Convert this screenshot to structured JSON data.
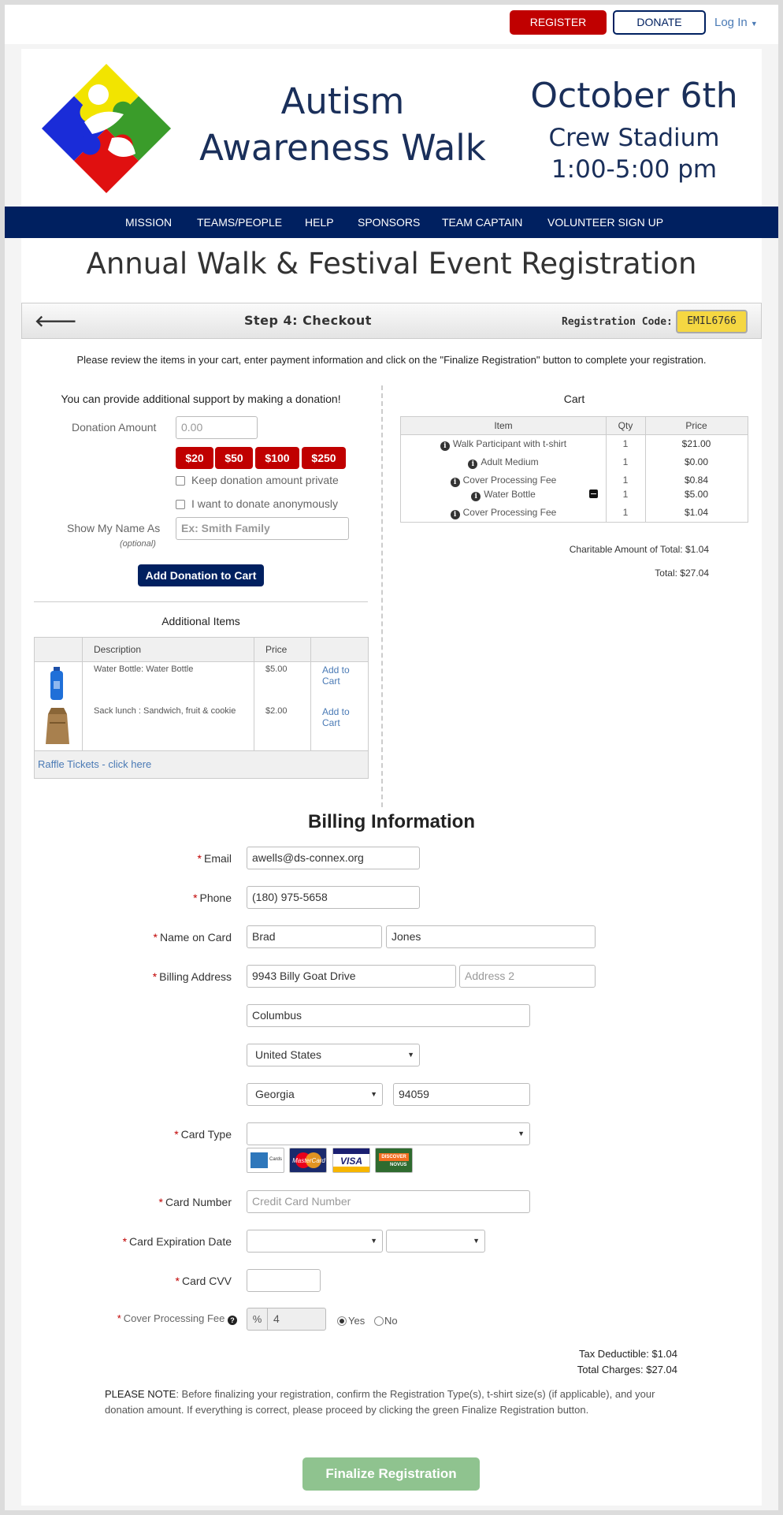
{
  "topbar": {
    "register": "REGISTER",
    "donate": "DONATE",
    "login": "Log In"
  },
  "hero": {
    "title_line1": "Autism",
    "title_line2": "Awareness Walk",
    "date": "October 6th",
    "venue": "Crew Stadium",
    "time": "1:00-5:00 pm"
  },
  "nav": [
    "MISSION",
    "TEAMS/PEOPLE",
    "HELP",
    "SPONSORS",
    "TEAM CAPTAIN",
    "VOLUNTEER SIGN UP"
  ],
  "page_title": "Annual Walk & Festival Event Registration",
  "step": {
    "title": "Step 4: Checkout",
    "reg_code_label": "Registration Code:",
    "reg_code": "EMIL6766"
  },
  "instructions": "Please review the items in your cart, enter payment information and click on the \"Finalize Registration\" button to complete your registration.",
  "donation": {
    "intro": "You can provide additional support by making a donation!",
    "amount_label": "Donation Amount",
    "amount_placeholder": "0.00",
    "quick_amounts": [
      "$20",
      "$50",
      "$100",
      "$250"
    ],
    "keep_private": "Keep donation amount private",
    "anonymous": "I want to donate anonymously",
    "show_name_label": "Show My Name As",
    "optional": "(optional)",
    "name_placeholder": "Ex: Smith Family",
    "add_button": "Add Donation to Cart"
  },
  "additional": {
    "title": "Additional Items",
    "headers": [
      "Description",
      "Price"
    ],
    "items": [
      {
        "description": "Water Bottle: Water Bottle",
        "price": "$5.00",
        "action": "Add to Cart",
        "icon": "water-bottle-icon"
      },
      {
        "description": "Sack lunch : Sandwich, fruit & cookie",
        "price": "$2.00",
        "action": "Add to Cart",
        "icon": "paper-bag-icon"
      }
    ],
    "raffle": "Raffle Tickets - click here"
  },
  "cart": {
    "title": "Cart",
    "headers": [
      "Item",
      "Qty",
      "Price"
    ],
    "rows": [
      {
        "item": "Walk Participant with t-shirt",
        "qty": "1",
        "price": "$21.00"
      },
      {
        "item": "Adult Medium",
        "qty": "1",
        "price": "$0.00"
      },
      {
        "item": "Cover Processing Fee",
        "qty": "1",
        "price": "$0.84"
      },
      {
        "item": "Water Bottle",
        "qty": "1",
        "price": "$5.00"
      },
      {
        "item": "Cover Processing Fee",
        "qty": "1",
        "price": "$1.04"
      }
    ],
    "charitable": "Charitable Amount of Total: $1.04",
    "total": "Total: $27.04"
  },
  "billing": {
    "title": "Billing Information",
    "email_label": "Email",
    "email": "awells@ds-connex.org",
    "phone_label": "Phone",
    "phone": "(180) 975-5658",
    "name_label": "Name on Card",
    "first_name": "Brad",
    "last_name": "Jones",
    "address_label": "Billing Address",
    "address1": "9943 Billy Goat Drive",
    "address2_placeholder": "Address 2",
    "city": "Columbus",
    "country": "United States",
    "state": "Georgia",
    "zip": "94059",
    "card_type_label": "Card Type",
    "card_type": "",
    "cards": [
      "American Express",
      "MasterCard",
      "VISA",
      "DISCOVER NOVUS"
    ],
    "card_number_label": "Card Number",
    "card_number_placeholder": "Credit Card Number",
    "expiration_label": "Card Expiration Date",
    "cvv_label": "Card CVV",
    "fee_label": "Cover Processing Fee",
    "fee_prefix": "%",
    "fee_value": "4",
    "fee_yes": "Yes",
    "fee_no": "No",
    "fee_selected": "Yes",
    "tax_deductible": "Tax Deductible: $1.04",
    "total_charges": "Total Charges: $27.04",
    "note_bold": "PLEASE NOTE",
    "note_text": ": Before finalizing your registration, confirm the Registration Type(s), t-shirt size(s) (if applicable), and your donation amount. If everything is correct, please proceed by clicking the green Finalize Registration button.",
    "finalize": "Finalize Registration"
  },
  "colors": {
    "brand_red": "#c00000",
    "navy": "#002060",
    "code_yellow": "#f5d742",
    "finalize_green": "#8fc38f",
    "link": "#4a7ab5"
  }
}
